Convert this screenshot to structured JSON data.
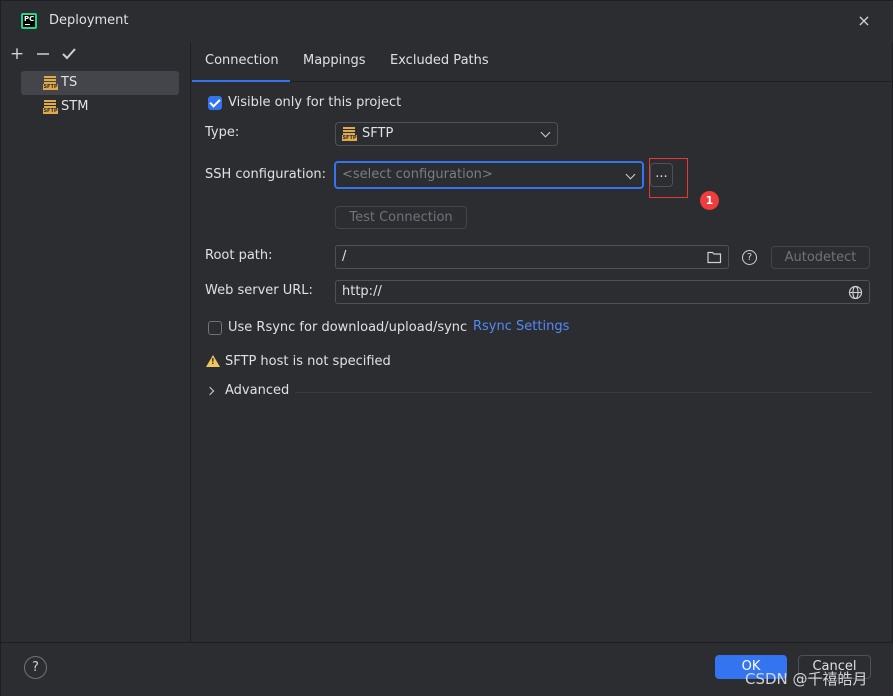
{
  "window": {
    "title": "Deployment",
    "close": "×"
  },
  "toolbar": {
    "add": "+",
    "remove": "—",
    "apply": "✔"
  },
  "servers": [
    {
      "label": "TS",
      "icon": "sftp-server-icon",
      "selected": true
    },
    {
      "label": "STM",
      "icon": "sftp-server-icon",
      "selected": false
    }
  ],
  "server_icon_label": "SFTP",
  "tabs": [
    {
      "label": "Connection",
      "active": true
    },
    {
      "label": "Mappings",
      "active": false
    },
    {
      "label": "Excluded Paths",
      "active": false
    }
  ],
  "connection": {
    "visible_only_label": "Visible only for this project",
    "visible_only_checked": true,
    "type_label": "Type:",
    "type_value": "SFTP",
    "ssh_label": "SSH configuration:",
    "ssh_placeholder": "<select configuration>",
    "browse_button": "...",
    "test_connection_button": "Test Connection",
    "root_path_label": "Root path:",
    "root_path_value": "/",
    "help_glyph": "?",
    "autodetect_button": "Autodetect",
    "web_url_label": "Web server URL:",
    "web_url_value": "http://",
    "rsync_label": "Use Rsync for download/upload/sync",
    "rsync_checked": false,
    "rsync_settings_link": "Rsync Settings",
    "warning_text": "SFTP host is not specified",
    "advanced_label": "Advanced"
  },
  "annotation": {
    "marker": "1",
    "color": "#e53935"
  },
  "footer": {
    "help": "?",
    "ok": "OK",
    "cancel": "Cancel"
  },
  "watermark": "CSDN @千禧皓月",
  "colors": {
    "accent": "#3574f0",
    "background": "#2b2d30",
    "link": "#548af7",
    "warning": "#f2c55c",
    "sftp_icon": "#e0a94a"
  }
}
